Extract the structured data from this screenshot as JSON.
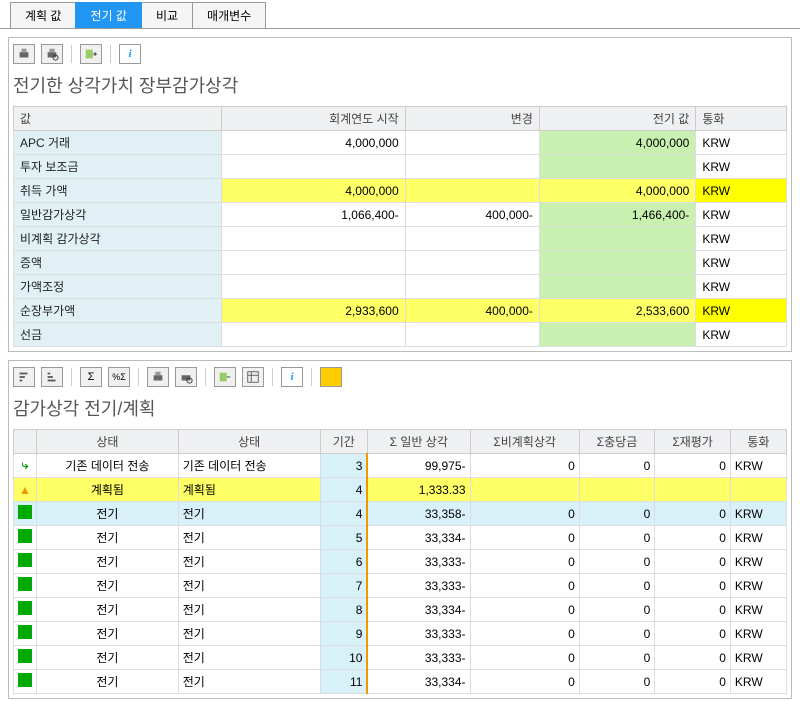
{
  "tabs": [
    "계획 값",
    "전기 값",
    "비교",
    "매개변수"
  ],
  "active_tab": 1,
  "upper": {
    "title": "전기한 상각가치 장부감가상각",
    "cols": [
      "값",
      "회계연도 시작",
      "변경",
      "전기 값",
      "통화"
    ],
    "rows": [
      {
        "label": "APC 거래",
        "fy": "4,000,000",
        "chg": "",
        "pv": "4,000,000",
        "cur": "KRW",
        "hl": "g"
      },
      {
        "label": "투자 보조금",
        "fy": "",
        "chg": "",
        "pv": "",
        "cur": "KRW",
        "hl": ""
      },
      {
        "label": "취득 가액",
        "fy": "4,000,000",
        "chg": "",
        "pv": "4,000,000",
        "cur": "KRW",
        "hl": "y"
      },
      {
        "label": "일반감가상각",
        "fy": "1,066,400-",
        "chg": "400,000-",
        "pv": "1,466,400-",
        "cur": "KRW",
        "hl": "g"
      },
      {
        "label": "비계획 감가상각",
        "fy": "",
        "chg": "",
        "pv": "",
        "cur": "KRW",
        "hl": ""
      },
      {
        "label": "증액",
        "fy": "",
        "chg": "",
        "pv": "",
        "cur": "KRW",
        "hl": ""
      },
      {
        "label": "가액조정",
        "fy": "",
        "chg": "",
        "pv": "",
        "cur": "KRW",
        "hl": ""
      },
      {
        "label": "순장부가액",
        "fy": "2,933,600",
        "chg": "400,000-",
        "pv": "2,533,600",
        "cur": "KRW",
        "hl": "y"
      },
      {
        "label": "선금",
        "fy": "",
        "chg": "",
        "pv": "",
        "cur": "KRW",
        "hl": ""
      }
    ]
  },
  "lower": {
    "title": "감가상각 전기/계획",
    "cols": [
      "",
      "상태",
      "상태",
      "기간",
      "Σ 일반 상각",
      "Σ비계획상각",
      "Σ충당금",
      "Σ재평가",
      "통화"
    ],
    "rows": [
      {
        "ic": "arrow",
        "s1": "기존 데이터 전송",
        "s2": "기존 데이터 전송",
        "p": "3",
        "od": "99,975-",
        "up": "0",
        "res": "0",
        "rev": "0",
        "cur": "KRW",
        "sty": ""
      },
      {
        "ic": "warn",
        "s1": "계획됨",
        "s2": "계획됨",
        "p": "4",
        "od": "1,333.33",
        "up": "",
        "res": "",
        "rev": "",
        "cur": "",
        "sty": "y"
      },
      {
        "ic": "green",
        "s1": "전기",
        "s2": "전기",
        "p": "4",
        "od": "33,358-",
        "up": "0",
        "res": "0",
        "rev": "0",
        "cur": "KRW",
        "sty": "c"
      },
      {
        "ic": "green",
        "s1": "전기",
        "s2": "전기",
        "p": "5",
        "od": "33,334-",
        "up": "0",
        "res": "0",
        "rev": "0",
        "cur": "KRW",
        "sty": ""
      },
      {
        "ic": "green",
        "s1": "전기",
        "s2": "전기",
        "p": "6",
        "od": "33,333-",
        "up": "0",
        "res": "0",
        "rev": "0",
        "cur": "KRW",
        "sty": ""
      },
      {
        "ic": "green",
        "s1": "전기",
        "s2": "전기",
        "p": "7",
        "od": "33,333-",
        "up": "0",
        "res": "0",
        "rev": "0",
        "cur": "KRW",
        "sty": ""
      },
      {
        "ic": "green",
        "s1": "전기",
        "s2": "전기",
        "p": "8",
        "od": "33,334-",
        "up": "0",
        "res": "0",
        "rev": "0",
        "cur": "KRW",
        "sty": ""
      },
      {
        "ic": "green",
        "s1": "전기",
        "s2": "전기",
        "p": "9",
        "od": "33,333-",
        "up": "0",
        "res": "0",
        "rev": "0",
        "cur": "KRW",
        "sty": ""
      },
      {
        "ic": "green",
        "s1": "전기",
        "s2": "전기",
        "p": "10",
        "od": "33,333-",
        "up": "0",
        "res": "0",
        "rev": "0",
        "cur": "KRW",
        "sty": ""
      },
      {
        "ic": "green",
        "s1": "전기",
        "s2": "전기",
        "p": "11",
        "od": "33,334-",
        "up": "0",
        "res": "0",
        "rev": "0",
        "cur": "KRW",
        "sty": ""
      }
    ]
  }
}
